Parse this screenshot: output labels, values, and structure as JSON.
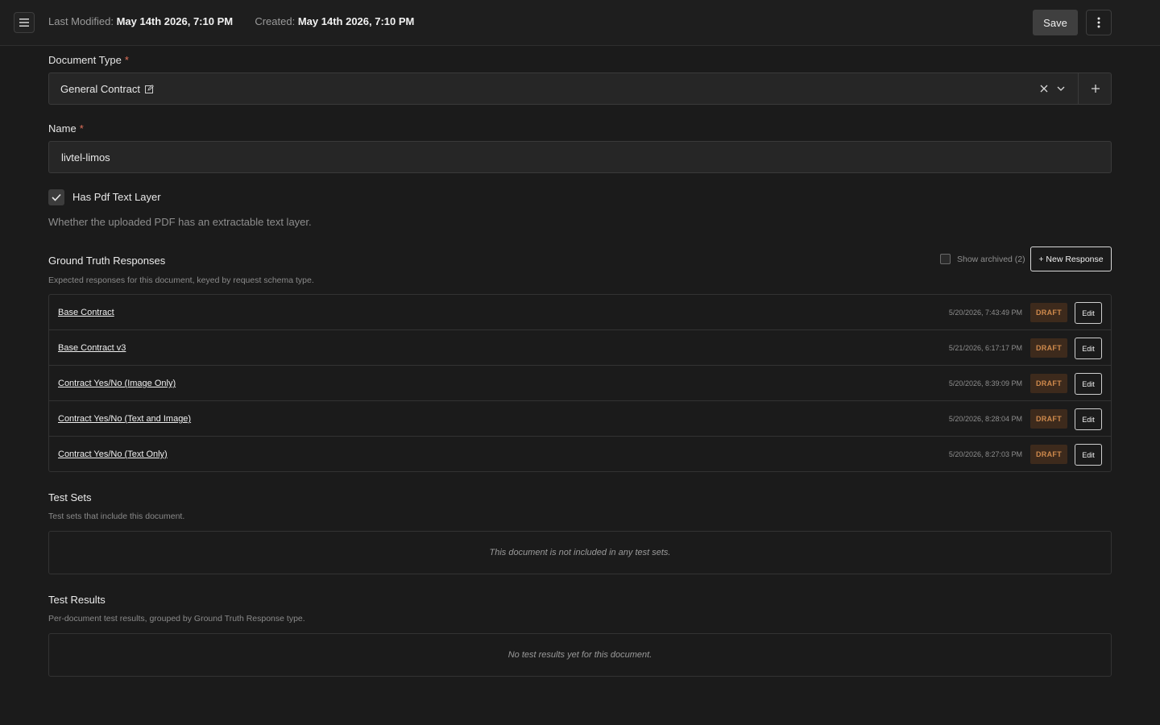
{
  "header": {
    "last_modified_label": "Last Modified:",
    "last_modified_value": "May 14th 2026, 7:10 PM",
    "created_label": "Created:",
    "created_value": "May 14th 2026, 7:10 PM",
    "save_label": "Save",
    "menu_icon": "hamburger-icon",
    "more_icon": "kebab-icon"
  },
  "document_type": {
    "label": "Document Type",
    "required_mark": "*",
    "value": "General Contract"
  },
  "name_field": {
    "label": "Name",
    "required_mark": "*",
    "value": "livtel-limos"
  },
  "pdf_text_layer": {
    "label": "Has Pdf Text Layer",
    "checked": true,
    "help": "Whether the uploaded PDF has an extractable text layer."
  },
  "ground_truth": {
    "title": "Ground Truth Responses",
    "subtitle": "Expected responses for this document, keyed by request schema type.",
    "show_archived_label": "Show archived (2)",
    "new_response_label": "+ New Response",
    "rows": [
      {
        "name": "Base Contract",
        "date": "5/20/2026, 7:43:49 PM",
        "status": "DRAFT",
        "edit": "Edit"
      },
      {
        "name": "Base Contract v3",
        "date": "5/21/2026, 6:17:17 PM",
        "status": "DRAFT",
        "edit": "Edit"
      },
      {
        "name": "Contract Yes/No (Image Only)",
        "date": "5/20/2026, 8:39:09 PM",
        "status": "DRAFT",
        "edit": "Edit"
      },
      {
        "name": "Contract Yes/No (Text and Image)",
        "date": "5/20/2026, 8:28:04 PM",
        "status": "DRAFT",
        "edit": "Edit"
      },
      {
        "name": "Contract Yes/No (Text Only)",
        "date": "5/20/2026, 8:27:03 PM",
        "status": "DRAFT",
        "edit": "Edit"
      }
    ]
  },
  "test_sets": {
    "title": "Test Sets",
    "subtitle": "Test sets that include this document.",
    "empty": "This document is not included in any test sets."
  },
  "test_results": {
    "title": "Test Results",
    "subtitle": "Per-document test results, grouped by Ground Truth Response type.",
    "empty": "No test results yet for this document."
  },
  "colors": {
    "background": "#1b1b1b",
    "draft_badge_bg": "#3d2a1c",
    "draft_badge_text": "#d08a4c",
    "required": "#e0705a"
  }
}
